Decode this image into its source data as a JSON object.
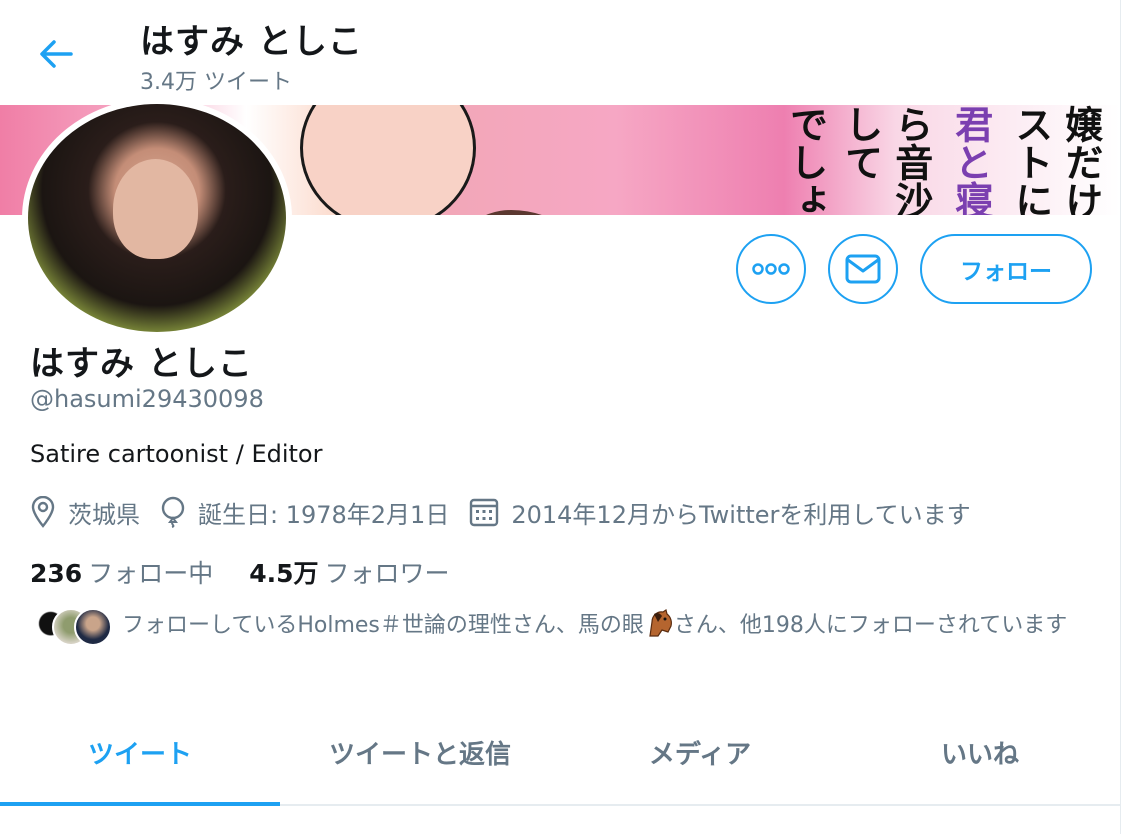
{
  "header": {
    "title": "はすみ としこ",
    "tweet_count": "3.4万 ツイート"
  },
  "banner": {
    "text_columns": [
      "嬢だけ",
      "ストにた",
      "君と寝て",
      "ら音沙汰",
      "して",
      "でしょ"
    ]
  },
  "actions": {
    "more_icon": "more-icon",
    "message_icon": "mail-icon",
    "follow_label": "フォロー",
    "accent_color": "#1da1f2"
  },
  "profile": {
    "display_name": "はすみ としこ",
    "handle": "@hasumi29430098",
    "bio": "Satire cartoonist / Editor",
    "location": "茨城県",
    "birthday": "誕生日: 1978年2月1日",
    "joined": "2014年12月からTwitterを利用しています"
  },
  "stats": {
    "following_count": "236",
    "following_label": "フォロー中",
    "followers_count": "4.5万",
    "followers_label": "フォロワー"
  },
  "followed_by": {
    "text_before": "フォローしているHolmes＃世論の理性さん、馬の眼",
    "text_after": "さん、他198人にフォローされています"
  },
  "tabs": [
    {
      "label": "ツイート",
      "active": true
    },
    {
      "label": "ツイートと返信",
      "active": false
    },
    {
      "label": "メディア",
      "active": false
    },
    {
      "label": "いいね",
      "active": false
    }
  ]
}
